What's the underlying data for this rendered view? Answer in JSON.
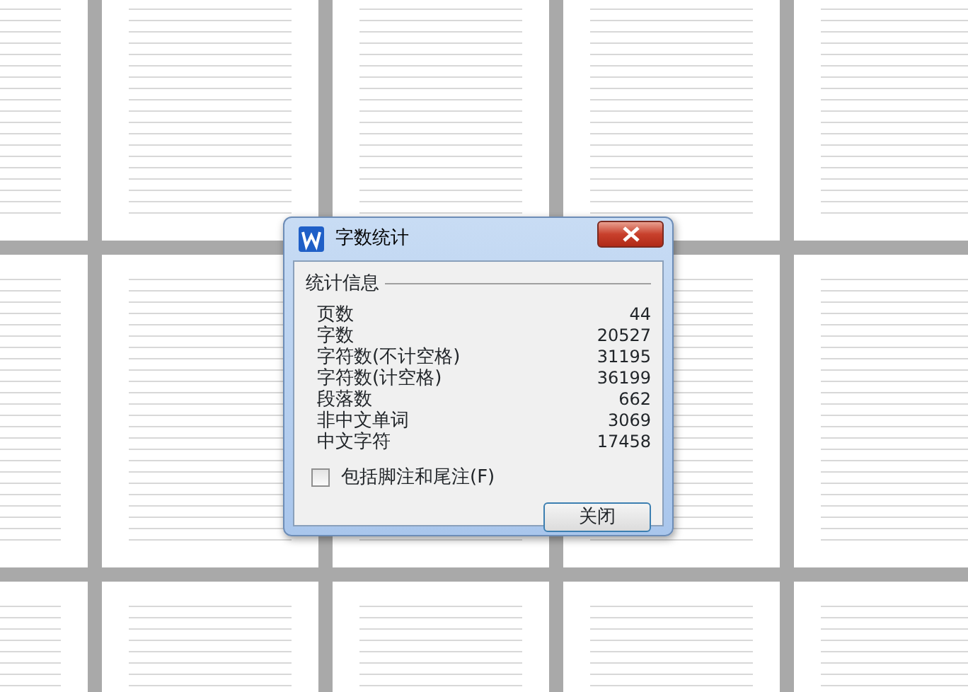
{
  "dialog": {
    "title": "字数统计",
    "section_title": "统计信息",
    "stats": [
      {
        "label": "页数",
        "value": "44"
      },
      {
        "label": "字数",
        "value": "20527"
      },
      {
        "label": "字符数(不计空格)",
        "value": "31195"
      },
      {
        "label": "字符数(计空格)",
        "value": "36199"
      },
      {
        "label": "段落数",
        "value": "662"
      },
      {
        "label": "非中文单词",
        "value": "3069"
      },
      {
        "label": "中文字符",
        "value": "17458"
      }
    ],
    "include_footnotes": {
      "label": "包括脚注和尾注(F)",
      "checked": false
    },
    "buttons": [
      "关闭"
    ]
  }
}
